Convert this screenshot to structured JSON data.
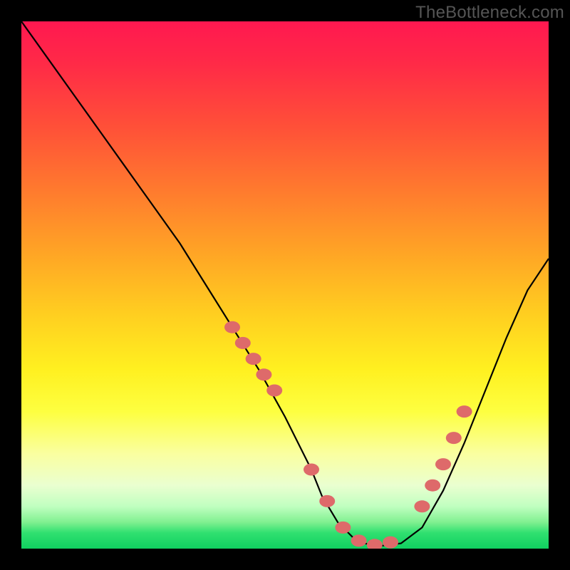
{
  "watermark": "TheBottleneck.com",
  "chart_data": {
    "type": "line",
    "title": "",
    "xlabel": "",
    "ylabel": "",
    "xlim": [
      0,
      100
    ],
    "ylim": [
      0,
      100
    ],
    "grid": false,
    "legend": false,
    "series": [
      {
        "name": "curve",
        "x": [
          0,
          5,
          10,
          15,
          20,
          25,
          30,
          35,
          40,
          45,
          50,
          55,
          57,
          60,
          63,
          65,
          68,
          72,
          76,
          80,
          84,
          88,
          92,
          96,
          100
        ],
        "y": [
          100,
          93,
          86,
          79,
          72,
          65,
          58,
          50,
          42,
          34,
          25,
          15,
          10,
          5,
          2,
          1,
          0.5,
          1,
          4,
          11,
          20,
          30,
          40,
          49,
          55
        ]
      }
    ],
    "markers": {
      "name": "highlight-dots",
      "color": "#de6a6a",
      "x": [
        40,
        42,
        44,
        46,
        48,
        55,
        58,
        61,
        64,
        67,
        70,
        76,
        78,
        80,
        82,
        84
      ],
      "y": [
        42,
        39,
        36,
        33,
        30,
        15,
        9,
        4,
        1.5,
        0.7,
        1.2,
        8,
        12,
        16,
        21,
        26
      ]
    },
    "background_gradient": {
      "stops": [
        {
          "pos": 0,
          "color": "#ff1850"
        },
        {
          "pos": 50,
          "color": "#ffd020"
        },
        {
          "pos": 80,
          "color": "#fdff60"
        },
        {
          "pos": 100,
          "color": "#10d060"
        }
      ]
    }
  }
}
